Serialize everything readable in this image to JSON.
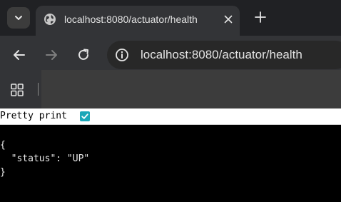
{
  "tab": {
    "title": "localhost:8080/actuator/health",
    "icons": {
      "favicon": "globe-icon",
      "close": "close-icon",
      "search_tabs": "chevron-down-icon",
      "new_tab": "plus-icon"
    }
  },
  "toolbar": {
    "url": "localhost:8080/actuator/health",
    "icons": {
      "back": "arrow-left-icon",
      "forward": "arrow-right-icon",
      "reload": "reload-icon",
      "site_info": "info-icon"
    }
  },
  "bookmarks": {
    "icons": {
      "apps": "apps-grid-icon"
    }
  },
  "page": {
    "pretty_print_label": "Pretty print",
    "pretty_print_checked": true,
    "json_line_1": "{",
    "json_line_2": "  \"status\": \"UP\"",
    "json_line_3": "}"
  },
  "colors": {
    "tabstrip_bg": "#202124",
    "toolbar_bg": "#333437",
    "omnibox_bg": "#282828",
    "checkbox_accent": "#1aa7b8",
    "page_bg": "#000000"
  }
}
